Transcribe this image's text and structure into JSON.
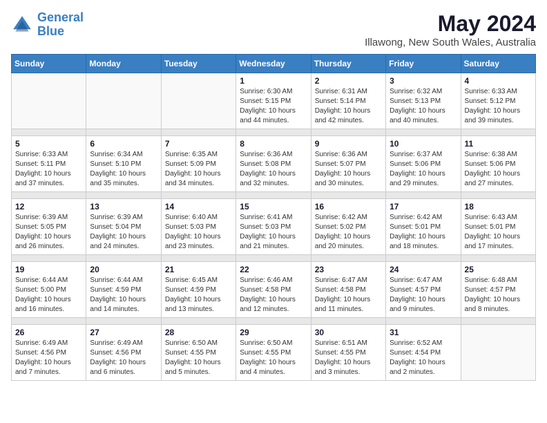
{
  "logo": {
    "text_general": "General",
    "text_blue": "Blue"
  },
  "title": "May 2024",
  "subtitle": "Illawong, New South Wales, Australia",
  "weekdays": [
    "Sunday",
    "Monday",
    "Tuesday",
    "Wednesday",
    "Thursday",
    "Friday",
    "Saturday"
  ],
  "weeks": [
    [
      {
        "day": "",
        "info": ""
      },
      {
        "day": "",
        "info": ""
      },
      {
        "day": "",
        "info": ""
      },
      {
        "day": "1",
        "info": "Sunrise: 6:30 AM\nSunset: 5:15 PM\nDaylight: 10 hours\nand 44 minutes."
      },
      {
        "day": "2",
        "info": "Sunrise: 6:31 AM\nSunset: 5:14 PM\nDaylight: 10 hours\nand 42 minutes."
      },
      {
        "day": "3",
        "info": "Sunrise: 6:32 AM\nSunset: 5:13 PM\nDaylight: 10 hours\nand 40 minutes."
      },
      {
        "day": "4",
        "info": "Sunrise: 6:33 AM\nSunset: 5:12 PM\nDaylight: 10 hours\nand 39 minutes."
      }
    ],
    [
      {
        "day": "5",
        "info": "Sunrise: 6:33 AM\nSunset: 5:11 PM\nDaylight: 10 hours\nand 37 minutes."
      },
      {
        "day": "6",
        "info": "Sunrise: 6:34 AM\nSunset: 5:10 PM\nDaylight: 10 hours\nand 35 minutes."
      },
      {
        "day": "7",
        "info": "Sunrise: 6:35 AM\nSunset: 5:09 PM\nDaylight: 10 hours\nand 34 minutes."
      },
      {
        "day": "8",
        "info": "Sunrise: 6:36 AM\nSunset: 5:08 PM\nDaylight: 10 hours\nand 32 minutes."
      },
      {
        "day": "9",
        "info": "Sunrise: 6:36 AM\nSunset: 5:07 PM\nDaylight: 10 hours\nand 30 minutes."
      },
      {
        "day": "10",
        "info": "Sunrise: 6:37 AM\nSunset: 5:06 PM\nDaylight: 10 hours\nand 29 minutes."
      },
      {
        "day": "11",
        "info": "Sunrise: 6:38 AM\nSunset: 5:06 PM\nDaylight: 10 hours\nand 27 minutes."
      }
    ],
    [
      {
        "day": "12",
        "info": "Sunrise: 6:39 AM\nSunset: 5:05 PM\nDaylight: 10 hours\nand 26 minutes."
      },
      {
        "day": "13",
        "info": "Sunrise: 6:39 AM\nSunset: 5:04 PM\nDaylight: 10 hours\nand 24 minutes."
      },
      {
        "day": "14",
        "info": "Sunrise: 6:40 AM\nSunset: 5:03 PM\nDaylight: 10 hours\nand 23 minutes."
      },
      {
        "day": "15",
        "info": "Sunrise: 6:41 AM\nSunset: 5:03 PM\nDaylight: 10 hours\nand 21 minutes."
      },
      {
        "day": "16",
        "info": "Sunrise: 6:42 AM\nSunset: 5:02 PM\nDaylight: 10 hours\nand 20 minutes."
      },
      {
        "day": "17",
        "info": "Sunrise: 6:42 AM\nSunset: 5:01 PM\nDaylight: 10 hours\nand 18 minutes."
      },
      {
        "day": "18",
        "info": "Sunrise: 6:43 AM\nSunset: 5:01 PM\nDaylight: 10 hours\nand 17 minutes."
      }
    ],
    [
      {
        "day": "19",
        "info": "Sunrise: 6:44 AM\nSunset: 5:00 PM\nDaylight: 10 hours\nand 16 minutes."
      },
      {
        "day": "20",
        "info": "Sunrise: 6:44 AM\nSunset: 4:59 PM\nDaylight: 10 hours\nand 14 minutes."
      },
      {
        "day": "21",
        "info": "Sunrise: 6:45 AM\nSunset: 4:59 PM\nDaylight: 10 hours\nand 13 minutes."
      },
      {
        "day": "22",
        "info": "Sunrise: 6:46 AM\nSunset: 4:58 PM\nDaylight: 10 hours\nand 12 minutes."
      },
      {
        "day": "23",
        "info": "Sunrise: 6:47 AM\nSunset: 4:58 PM\nDaylight: 10 hours\nand 11 minutes."
      },
      {
        "day": "24",
        "info": "Sunrise: 6:47 AM\nSunset: 4:57 PM\nDaylight: 10 hours\nand 9 minutes."
      },
      {
        "day": "25",
        "info": "Sunrise: 6:48 AM\nSunset: 4:57 PM\nDaylight: 10 hours\nand 8 minutes."
      }
    ],
    [
      {
        "day": "26",
        "info": "Sunrise: 6:49 AM\nSunset: 4:56 PM\nDaylight: 10 hours\nand 7 minutes."
      },
      {
        "day": "27",
        "info": "Sunrise: 6:49 AM\nSunset: 4:56 PM\nDaylight: 10 hours\nand 6 minutes."
      },
      {
        "day": "28",
        "info": "Sunrise: 6:50 AM\nSunset: 4:55 PM\nDaylight: 10 hours\nand 5 minutes."
      },
      {
        "day": "29",
        "info": "Sunrise: 6:50 AM\nSunset: 4:55 PM\nDaylight: 10 hours\nand 4 minutes."
      },
      {
        "day": "30",
        "info": "Sunrise: 6:51 AM\nSunset: 4:55 PM\nDaylight: 10 hours\nand 3 minutes."
      },
      {
        "day": "31",
        "info": "Sunrise: 6:52 AM\nSunset: 4:54 PM\nDaylight: 10 hours\nand 2 minutes."
      },
      {
        "day": "",
        "info": ""
      }
    ]
  ]
}
